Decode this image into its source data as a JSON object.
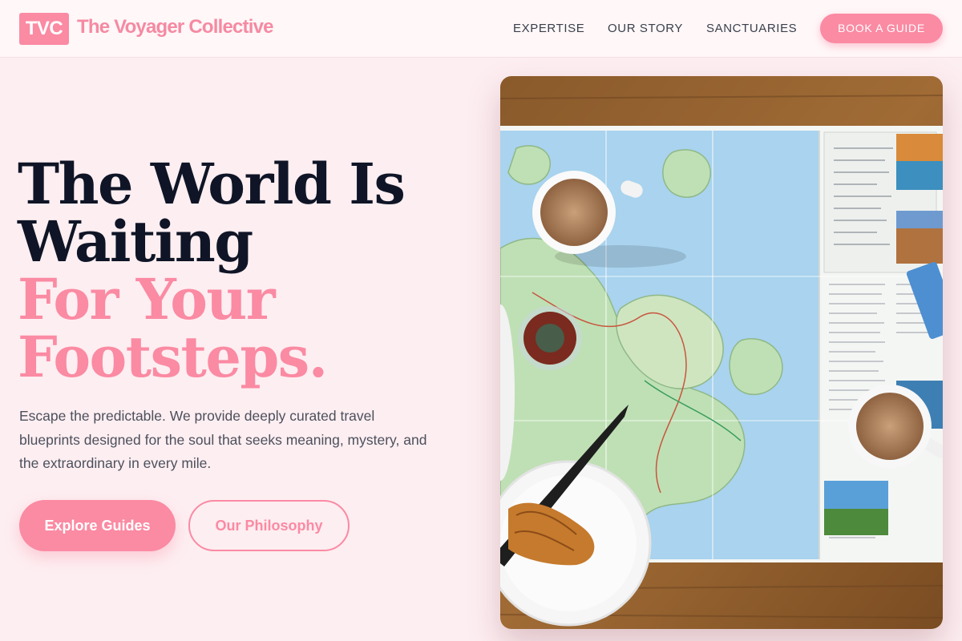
{
  "header": {
    "logo_badge": "TVC",
    "brand_name": "The Voyager Collective",
    "nav": [
      "EXPERTISE",
      "OUR STORY",
      "SANCTUARIES"
    ],
    "cta_label": "BOOK A GUIDE"
  },
  "hero": {
    "headline_line1": "The World Is",
    "headline_line2": "Waiting",
    "headline_line3": "For Your",
    "headline_line4": "Footsteps.",
    "subtext": "Escape the predictable. We provide deeply curated travel blueprints designed for the soul that seeks meaning, mystery, and the extraordinary in every mile.",
    "primary_button": "Explore Guides",
    "secondary_button": "Our Philosophy"
  },
  "colors": {
    "accent": "#fb8aa3",
    "background": "#fdeef1",
    "headline_dark": "#0f1526"
  },
  "image": {
    "subject": "map-coffee-croissant-photo"
  }
}
